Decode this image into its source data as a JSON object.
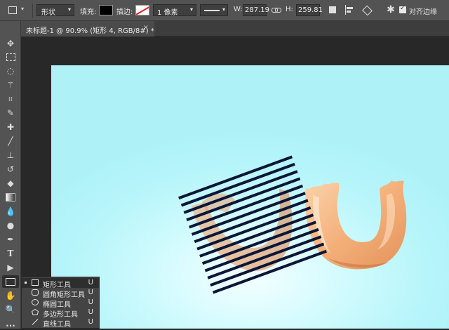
{
  "options_bar": {
    "mode": "形状",
    "fill_label": "填充:",
    "stroke_label": "描边:",
    "stroke_width": "1 像素",
    "width_label": "W:",
    "width_value": "287.19",
    "height_label": "H:",
    "height_value": "259.81",
    "align_edges_label": "对齐边缘",
    "align_edges_checked": true
  },
  "document_tab": {
    "title": "未标题-1 @ 90.9% (矩形 4, RGB/8#) *",
    "close": "×"
  },
  "toolbar": {
    "tools": [
      "move",
      "marquee",
      "lasso",
      "magic-wand",
      "crop",
      "eyedropper",
      "healing-brush",
      "brush",
      "clone-stamp",
      "history-brush",
      "eraser",
      "gradient",
      "blur",
      "dodge",
      "pen",
      "type",
      "path-selection",
      "rectangle",
      "hand",
      "zoom",
      "more"
    ],
    "type_glyph": "T",
    "more_glyph": "..."
  },
  "flyout": {
    "items": [
      {
        "label": "矩形工具",
        "key": "U",
        "icon": "rectangle-icon",
        "active": true
      },
      {
        "label": "圆角矩形工具",
        "key": "U",
        "icon": "rounded-rectangle-icon",
        "active": false
      },
      {
        "label": "椭圆工具",
        "key": "U",
        "icon": "ellipse-icon",
        "active": false
      },
      {
        "label": "多边形工具",
        "key": "U",
        "icon": "polygon-icon",
        "active": false
      },
      {
        "label": "直线工具",
        "key": "U",
        "icon": "line-icon",
        "active": false
      }
    ]
  },
  "colors": {
    "fill": "#000000",
    "stripes": "#0a1638",
    "letter": "#f2b07c",
    "canvas_bg": "#b6f5fa"
  }
}
